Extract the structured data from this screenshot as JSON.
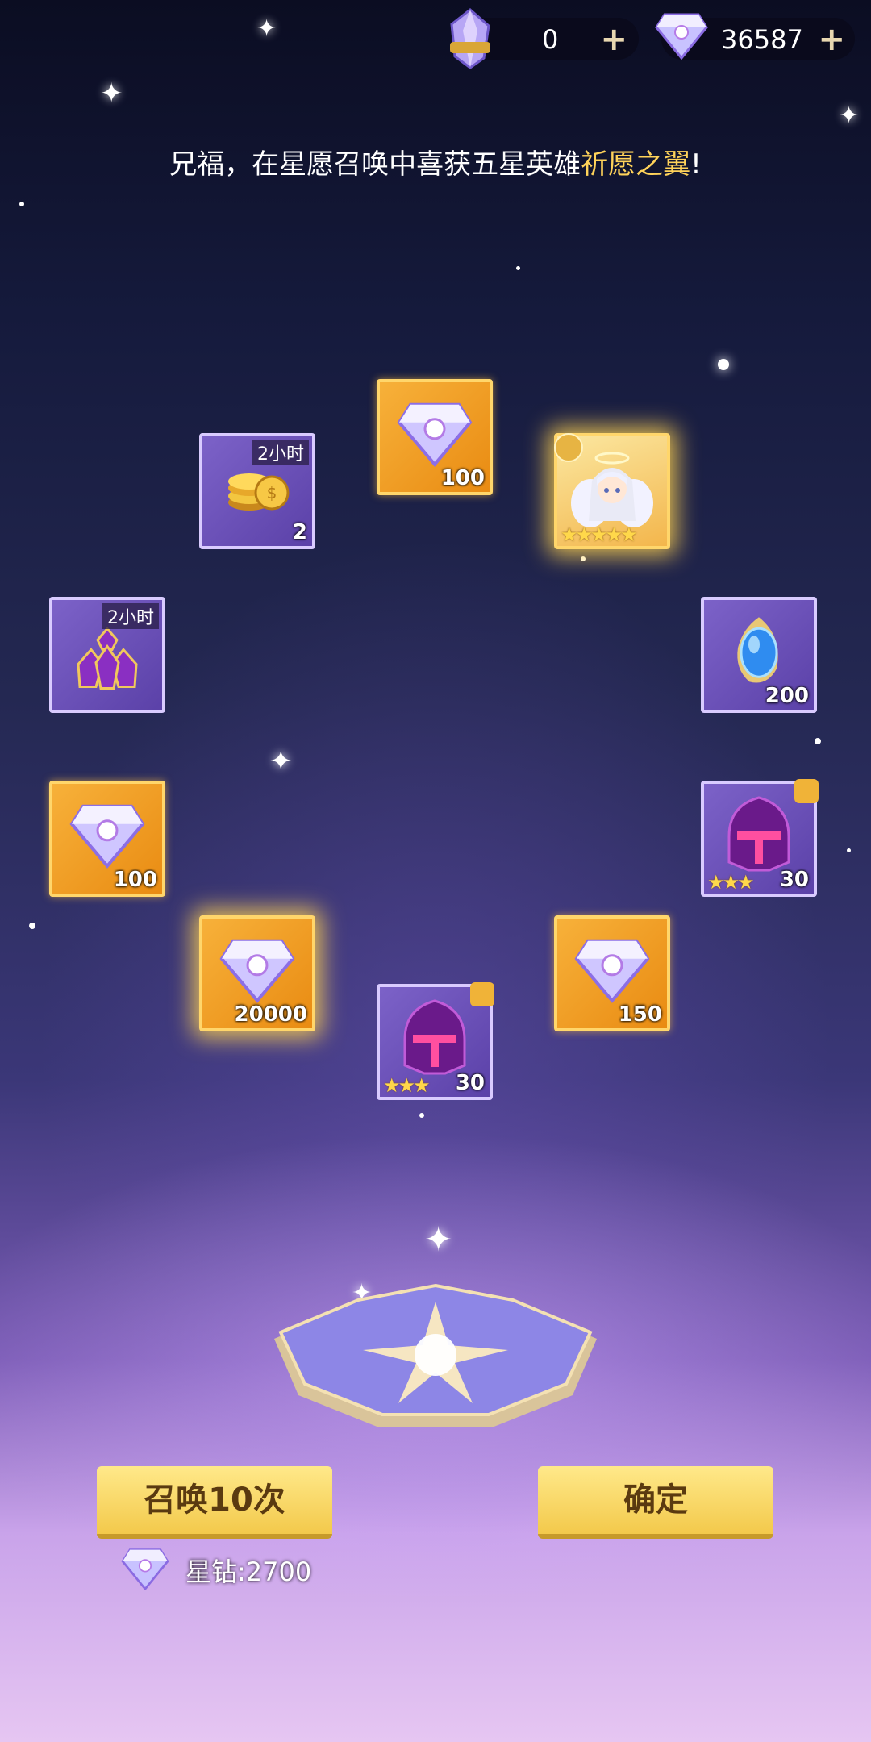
{
  "currency": {
    "tickets": {
      "icon": "summon-crystal-icon",
      "value": "0"
    },
    "diamonds": {
      "icon": "star-diamond-icon",
      "value": "36587"
    }
  },
  "announcement": {
    "prefix": "兄福，在星愿召唤中喜获五星英雄",
    "hero_name": "祈愿之翼",
    "suffix": "!"
  },
  "rewards": [
    {
      "icon": "gold-coins-icon",
      "count": "2",
      "duration": "2小时",
      "frame": "purple"
    },
    {
      "icon": "star-diamond-icon",
      "count": "100",
      "frame": "gold"
    },
    {
      "icon": "angel-hero-portrait",
      "stars": "★★★★★",
      "frame": "gold"
    },
    {
      "icon": "potion-bottles-icon",
      "duration": "2小时",
      "frame": "purple"
    },
    {
      "icon": "blue-gem-icon",
      "count": "200",
      "frame": "purple"
    },
    {
      "icon": "star-diamond-icon",
      "count": "100",
      "frame": "gold"
    },
    {
      "icon": "helmet-fragment-icon",
      "count": "30",
      "stars": "★★★",
      "frame": "purple"
    },
    {
      "icon": "star-diamond-icon",
      "count": "20000",
      "frame": "gold"
    },
    {
      "icon": "star-diamond-icon",
      "count": "150",
      "frame": "gold"
    },
    {
      "icon": "helmet-fragment-icon",
      "count": "30",
      "stars": "★★★",
      "frame": "purple"
    }
  ],
  "buttons": {
    "summon_label": "召唤10次",
    "confirm_label": "确定"
  },
  "cost": {
    "icon": "star-diamond-icon",
    "label": "星钻:2700"
  },
  "colors": {
    "gold": "#f7b13a",
    "purple": "#6a50b8",
    "highlight": "#ffd35a"
  }
}
